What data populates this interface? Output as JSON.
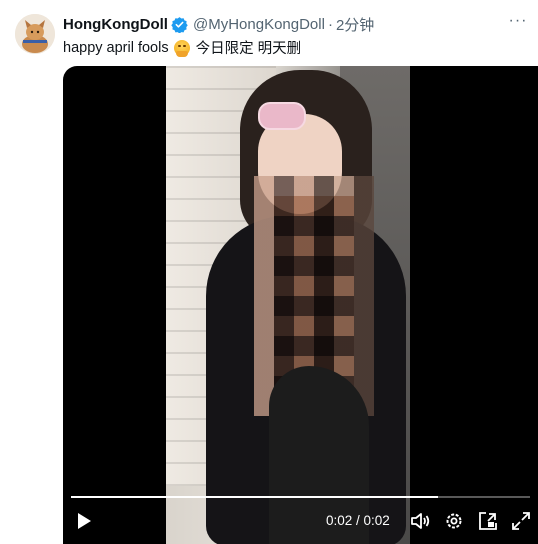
{
  "tweet": {
    "display_name": "HongKongDoll",
    "handle": "@MyHongKongDoll",
    "separator": "·",
    "time": "2分钟",
    "more_label": "···",
    "text_before_emoji": "happy april fools",
    "text_after_emoji": "今日限定 明天删",
    "verified_color": "#1d9bf0"
  },
  "video": {
    "progress": 0.8,
    "time_display": "0:02 / 0:02",
    "controls": [
      "play-icon",
      "volume-icon",
      "settings-icon",
      "pip-icon",
      "fullscreen-icon"
    ]
  }
}
